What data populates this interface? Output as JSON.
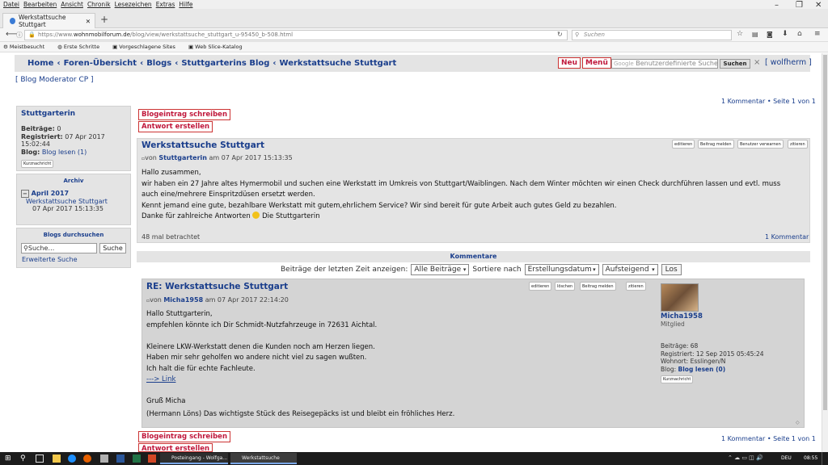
{
  "browser": {
    "menu": [
      "Datei",
      "Bearbeiten",
      "Ansicht",
      "Chronik",
      "Lesezeichen",
      "Extras",
      "Hilfe"
    ],
    "tab_title": "Werkstattsuche Stuttgart",
    "url_prefix": "https://www.",
    "url_domain": "wohnmobilforum.de",
    "url_path": "/blog/view/werkstattsuche_stuttgart_u-95450_b-508.html",
    "search_placeholder": "Suchen",
    "bookmarks": [
      "Meistbesucht",
      "Erste Schritte",
      "Vorgeschlagene Sites",
      "Web Slice-Katalog"
    ]
  },
  "header": {
    "breadcrumbs": [
      "Home",
      "Foren-Übersicht",
      "Blogs",
      "Stuttgarterins Blog",
      "Werkstattsuche Stuttgart"
    ],
    "sep": "‹",
    "neu": "Neu",
    "menu": "Menü",
    "search_placeholder": "Benutzerdefinierte Suche",
    "search_logo": "Google",
    "search_button": "Suchen",
    "close": "×",
    "user_link": "[ wolfherm ]"
  },
  "moderator_link": "[ Blog Moderator CP ]",
  "page_info": "1 Kommentar • Seite 1 von 1",
  "sidebar": {
    "author": "Stuttgarterin",
    "posts_label": "Beiträge:",
    "posts": "0",
    "registered_label": "Registriert:",
    "registered": "07 Apr 2017 15:02:44",
    "blog_label": "Blog:",
    "blog_link": "Blog lesen (1)",
    "pm_button": "Kurznachricht",
    "archive_title": "Archiv",
    "archive_month": "April 2017",
    "archive_entry": "Werkstattsuche Stuttgart",
    "archive_date": "07 Apr 2017 15:13:35",
    "search_title": "Blogs durchsuchen",
    "search_placeholder": "Suche…",
    "search_button": "Suche",
    "advanced_search": "Erweiterte Suche"
  },
  "actions": {
    "write": "Blogeintrag schreiben",
    "reply": "Antwort erstellen"
  },
  "post": {
    "title": "Werkstattsuche Stuttgart",
    "buttons": [
      "editieren",
      "Beitrag melden",
      "Benutzer verwarnen",
      "zitieren"
    ],
    "by": "von",
    "author": "Stuttgarterin",
    "date": "am 07 Apr 2017 15:13:35",
    "lines": [
      "Hallo zusammen,",
      "wir haben ein 27 Jahre altes Hymermobil und suchen eine Werkstatt im Umkreis von Stuttgart/Waiblingen. Nach dem Winter möchten wir einen Check durchführen lassen und evtl. muss",
      "auch eine/mehrere Einspritzdüsen ersetzt werden.",
      "Kennt jemand eine gute, bezahlbare Werkstatt mit gutem,ehrlichem Service? Wir sind bereit für gute Arbeit auch gutes Geld zu bezahlen.",
      "Danke für zahlreiche Antworten",
      "Die Stuttgarterin"
    ],
    "views": "48 mal betrachtet",
    "comments": "1 Kommentar"
  },
  "comments": {
    "title": "Kommentare",
    "filter_label": "Beiträge der letzten Zeit anzeigen:",
    "filter_value": "Alle Beiträge",
    "sort_label": "Sortiere nach",
    "sort_value": "Erstellungsdatum",
    "order_value": "Aufsteigend",
    "go_button": "Los"
  },
  "reply": {
    "title": "RE: Werkstattsuche Stuttgart",
    "buttons": [
      "editieren",
      "löschen",
      "Beitrag melden",
      "zitieren"
    ],
    "by": "von",
    "author": "Micha1958",
    "date": "am 07 Apr 2017 22:14:20",
    "lines": [
      "Hallo Stuttgarterin,",
      "empfehlen könnte ich Dir Schmidt-Nutzfahrzeuge in 72631 Aichtal.",
      "",
      "Kleinere LKW-Werkstatt denen die Kunden noch am Herzen liegen.",
      "Haben mir sehr geholfen wo andere nicht viel zu sagen wußten.",
      "Ich halt die für echte Fachleute."
    ],
    "link": "---> Link",
    "greeting": "Gruß Micha",
    "signature": "(Hermann Löns) Das wichtigste Stück des Reisegepäcks ist und bleibt ein fröhliches Herz.",
    "profile": {
      "name": "Micha1958",
      "rank": "Mitglied",
      "posts_label": "Beiträge:",
      "posts": "68",
      "registered_label": "Registriert:",
      "registered": "12 Sep 2015 05:45:24",
      "location_label": "Wohnort:",
      "location": "Esslingen/N",
      "blog_label": "Blog:",
      "blog_link": "Blog lesen (0)",
      "pm_button": "Kurznachricht"
    }
  },
  "taskbar": {
    "tasks": [
      "Posteingang - Wolfga...",
      "Werkstattsuche Stutt..."
    ],
    "lang": "DEU",
    "time": "08:55"
  }
}
